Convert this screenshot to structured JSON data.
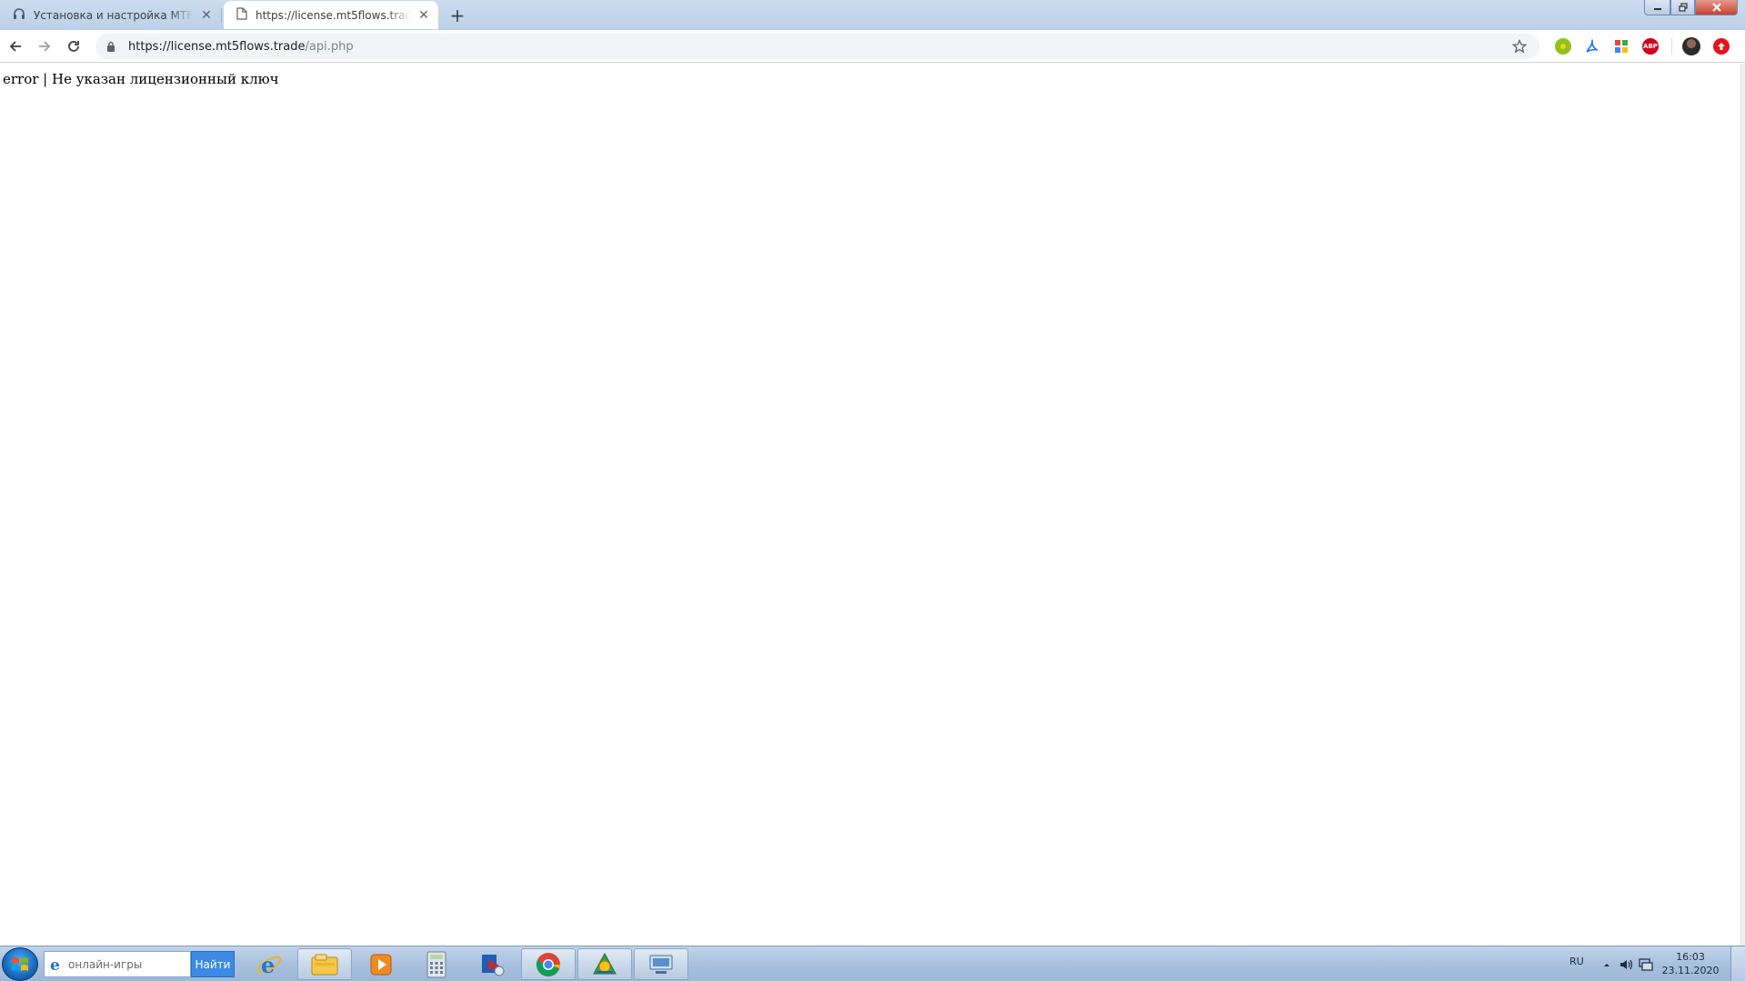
{
  "browser": {
    "tabs": [
      {
        "title": "Установка и настройка MTFlows",
        "favicon": "headphones-icon",
        "active": false
      },
      {
        "title": "https://license.mt5flows.trade/api.php",
        "favicon": "page-icon",
        "active": true
      }
    ],
    "new_tab": "+",
    "address": {
      "host": "https://license.mt5flows.trade",
      "path": "/api.php"
    },
    "extensions": [
      "green-extension-icon",
      "acrobat-icon",
      "grid-extension-icon",
      "adblock-icon",
      "avatar",
      "red-extension-icon"
    ],
    "extension_label_abp": "ABP"
  },
  "page": {
    "text": "error | Не указан лицензионный ключ"
  },
  "taskbar": {
    "search_placeholder": "онлайн-игры",
    "search_button": "Найти",
    "apps": [
      "internet-explorer-icon",
      "explorer-icon",
      "media-player-icon",
      "calculator-icon",
      "outlook-icon",
      "chrome-icon",
      "metatrader-icon",
      "network-icon"
    ],
    "language": "RU",
    "time": "16:03",
    "date": "23.11.2020"
  },
  "colors": {
    "tabstrip": "#cbdcef",
    "active_tab": "#ffffff",
    "omnibox": "#f1f3f4",
    "taskbar": "#a9c1de",
    "search_button": "#3c8ae6"
  }
}
